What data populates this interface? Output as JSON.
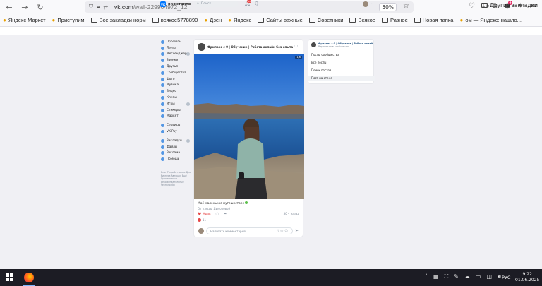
{
  "browser": {
    "url_host": "vk.com",
    "url_path": "/wall-229904972_12",
    "zoom": "50%",
    "back_icon": "arrow-left-icon",
    "forward_icon": "arrow-right-icon",
    "reload_icon": "reload-icon",
    "notif_badge": "4"
  },
  "bookmarks": [
    {
      "label": "Яндекс Маркет",
      "icon": "yandex-market-icon",
      "type": "site"
    },
    {
      "label": "Приступим",
      "icon": "firefox-icon",
      "type": "site"
    },
    {
      "label": "Все закладки норм",
      "icon": "folder-icon",
      "type": "folder"
    },
    {
      "label": "всякое5778890",
      "icon": "folder-icon",
      "type": "folder"
    },
    {
      "label": "Дзен",
      "icon": "dzen-icon",
      "type": "site"
    },
    {
      "label": "Яндекс",
      "icon": "yandex-icon",
      "type": "site"
    },
    {
      "label": "Сайты важные",
      "icon": "folder-icon",
      "type": "folder"
    },
    {
      "label": "Советники",
      "icon": "folder-icon",
      "type": "folder"
    },
    {
      "label": "Всякое",
      "icon": "folder-icon",
      "type": "folder"
    },
    {
      "label": "Разное",
      "icon": "folder-icon",
      "type": "folder"
    },
    {
      "label": "Новая папка",
      "icon": "folder-icon",
      "type": "folder"
    },
    {
      "label": "ом — Яндекс: нашло...",
      "icon": "yandex-icon",
      "type": "site"
    }
  ],
  "bookmarks_other": "Другие закладки",
  "vk": {
    "logo_text": "вконтакте",
    "search_placeholder": "Поиск",
    "bell_badge": "15"
  },
  "menu": {
    "group1": [
      "Профиль",
      "Лента",
      "Мессенджер",
      "Звонки",
      "Друзья",
      "Сообщества",
      "Фото",
      "Музыка",
      "Видео",
      "Клипы",
      "Игры",
      "Стикеры",
      "Маркет"
    ],
    "group2": [
      "Сервисы",
      "VK Pay"
    ],
    "group3": [
      "Закладки",
      "Файлы",
      "Реклама",
      "Помощь"
    ],
    "footer": [
      "Блог",
      "Разработчикам",
      "Для бизнеса",
      "Авторам",
      "Ещё",
      "Применяются",
      "рекомендательные",
      "технологии"
    ]
  },
  "post": {
    "author": "Фриланс с 0 | Обучение | Работа онлайн без опыта",
    "photo_counter": "1/6",
    "text": "Моё маленькое путешествие",
    "subtext": "От плюды Диморовой",
    "like_label": "Нрав",
    "time": "30 ч назад",
    "like_count": "11",
    "comment_placeholder": "Написать комментарий..."
  },
  "right_panel": {
    "group_title": "Фриланс с 0 | Обучение | Работа онлайн б...",
    "back_label": "Вернуться в сообщество",
    "items": [
      "Посты сообщества",
      "Все посты",
      "Поиск постов",
      "Пост на стене"
    ],
    "active_index": 3
  },
  "taskbar": {
    "lang": "РУС",
    "time": "9:22",
    "date": "01.06.2025"
  }
}
